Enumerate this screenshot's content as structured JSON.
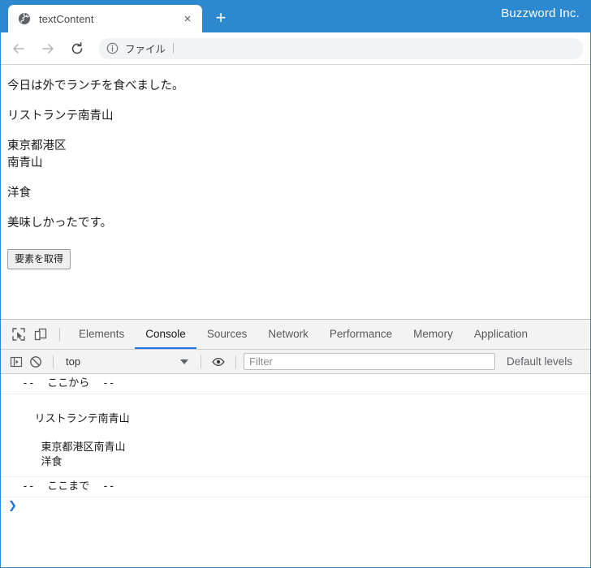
{
  "browser": {
    "brand_label": "Buzzword Inc.",
    "accent_color": "#2d89cf",
    "tab": {
      "title": "textContent",
      "favicon": "globe-icon",
      "close_label": "×"
    },
    "new_tab_label": "+",
    "omnibox": {
      "info_icon": "info-circle-icon",
      "value": "ファイル"
    },
    "nav": {
      "back": "back-arrow-icon",
      "forward": "forward-arrow-icon",
      "reload": "reload-icon"
    }
  },
  "page": {
    "paragraphs": [
      "今日は外でランチを食べました。",
      "リストランテ南青山",
      "東京都港区\n南青山",
      "洋食",
      "美味しかったです。"
    ],
    "button_label": "要素を取得"
  },
  "devtools": {
    "inspect_icon": "inspect-element-icon",
    "device_icon": "device-toolbar-icon",
    "tabs": [
      {
        "label": "Elements",
        "active": false
      },
      {
        "label": "Console",
        "active": true
      },
      {
        "label": "Sources",
        "active": false
      },
      {
        "label": "Network",
        "active": false
      },
      {
        "label": "Performance",
        "active": false
      },
      {
        "label": "Memory",
        "active": false
      },
      {
        "label": "Application",
        "active": false
      }
    ],
    "console_toolbar": {
      "sidebar_icon": "console-sidebar-icon",
      "clear_icon": "clear-console-icon",
      "context": "top",
      "eye_icon": "eye-icon",
      "filter_placeholder": "Filter",
      "levels_label": "Default levels"
    },
    "console_messages": [
      "--  ここから  --",
      "\n  リストランテ南青山\n\n   東京都港区南青山\n   洋食\n",
      "--  ここまで  --"
    ],
    "prompt_caret": "❯"
  }
}
